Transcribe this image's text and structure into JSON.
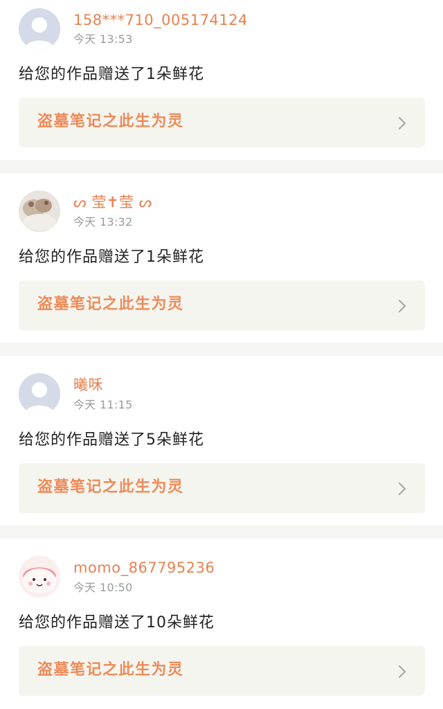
{
  "colors": {
    "accent": "#e8814f",
    "work_title": "#ee8a58",
    "time": "#9a9a9a",
    "message": "#222222",
    "link_bg": "#f5f5ef",
    "separator": "#f5f5f4"
  },
  "notifications": [
    {
      "username": "158***710_005174124",
      "time": "今天 13:53",
      "message": "给您的作品赠送了1朵鲜花",
      "work_title": "盗墓笔记之此生为灵",
      "avatar": "default-avatar-icon"
    },
    {
      "username": "ᔕ 莹✝莹 ᔕ",
      "time": "今天 13:32",
      "message": "给您的作品赠送了1朵鲜花",
      "work_title": "盗墓笔记之此生为灵",
      "avatar": "photo-avatar"
    },
    {
      "username": "曦咊",
      "time": "今天 11:15",
      "message": "给您的作品赠送了5朵鲜花",
      "work_title": "盗墓笔记之此生为灵",
      "avatar": "default-avatar-icon"
    },
    {
      "username": "momo_867795236",
      "time": "今天 10:50",
      "message": "给您的作品赠送了10朵鲜花",
      "work_title": "盗墓笔记之此生为灵",
      "avatar": "cartoon-avatar"
    }
  ]
}
